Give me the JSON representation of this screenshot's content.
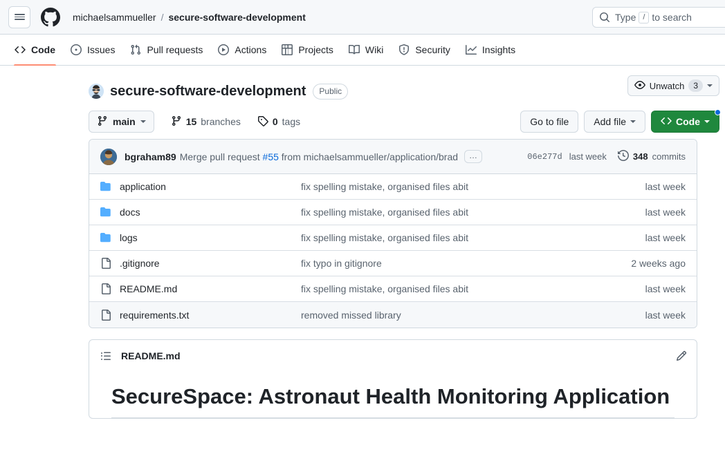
{
  "header": {
    "menu_icon": "hamburger-menu-icon",
    "logo_icon": "github-logo-icon",
    "owner": "michaelsammueller",
    "separator": "/",
    "repo": "secure-software-development",
    "search": {
      "icon": "search-icon",
      "prefix": "Type",
      "key": "/",
      "suffix": "to search",
      "placeholder": "Type / to search"
    }
  },
  "nav_tabs": [
    {
      "label": "Code",
      "icon": "code-icon",
      "active": true
    },
    {
      "label": "Issues",
      "icon": "issue-opened-icon",
      "active": false
    },
    {
      "label": "Pull requests",
      "icon": "git-pull-request-icon",
      "active": false
    },
    {
      "label": "Actions",
      "icon": "play-icon",
      "active": false
    },
    {
      "label": "Projects",
      "icon": "table-icon",
      "active": false
    },
    {
      "label": "Wiki",
      "icon": "book-icon",
      "active": false
    },
    {
      "label": "Security",
      "icon": "shield-icon",
      "active": false
    },
    {
      "label": "Insights",
      "icon": "graph-icon",
      "active": false
    }
  ],
  "repo_header": {
    "avatar": "owner-avatar",
    "name": "secure-software-development",
    "visibility": "Public",
    "watch": {
      "icon": "eye-icon",
      "label": "Unwatch",
      "count": "3"
    }
  },
  "branch_bar": {
    "branch_icon": "git-branch-icon",
    "branch": "main",
    "branches_count": "15",
    "branches_label": "branches",
    "tags_icon": "tag-icon",
    "tags_count": "0",
    "tags_label": "tags",
    "go_to_file": "Go to file",
    "add_file": "Add file",
    "code_button": "Code",
    "code_icon": "code-icon"
  },
  "commit_bar": {
    "avatar": "committer-avatar",
    "author": "bgraham89",
    "message_before": "Merge pull request ",
    "message_link": "#55",
    "message_after": " from michaelsammueller/application/brad",
    "expand_label": "…",
    "sha": "06e277d",
    "when": "last week",
    "history_icon": "history-icon",
    "commits_count": "348",
    "commits_label": "commits"
  },
  "files": [
    {
      "name": "application",
      "type": "folder",
      "icon": "folder-icon",
      "message": "fix spelling mistake, organised files abit",
      "when": "last week",
      "shaded": false
    },
    {
      "name": "docs",
      "type": "folder",
      "icon": "folder-icon",
      "message": "fix spelling mistake, organised files abit",
      "when": "last week",
      "shaded": false
    },
    {
      "name": "logs",
      "type": "folder",
      "icon": "folder-icon",
      "message": "fix spelling mistake, organised files abit",
      "when": "last week",
      "shaded": false
    },
    {
      "name": ".gitignore",
      "type": "file",
      "icon": "file-icon",
      "message": "fix typo in gitignore",
      "when": "2 weeks ago",
      "shaded": false
    },
    {
      "name": "README.md",
      "type": "file",
      "icon": "file-icon",
      "message": "fix spelling mistake, organised files abit",
      "when": "last week",
      "shaded": false
    },
    {
      "name": "requirements.txt",
      "type": "file",
      "icon": "file-icon",
      "message": "removed missed library",
      "when": "last week",
      "shaded": true
    }
  ],
  "readme": {
    "list_icon": "list-unordered-icon",
    "title": "README.md",
    "edit_icon": "pencil-icon",
    "heading": "SecureSpace: Astronaut Health Monitoring Application"
  },
  "colors": {
    "accent_green": "#1f883d",
    "link_blue": "#0969da",
    "active_tab_underline": "#fd8c73",
    "folder_blue": "#54aeff",
    "header_bg": "#f6f8fa",
    "border": "#d1d9e0",
    "muted_text": "#59636e"
  }
}
